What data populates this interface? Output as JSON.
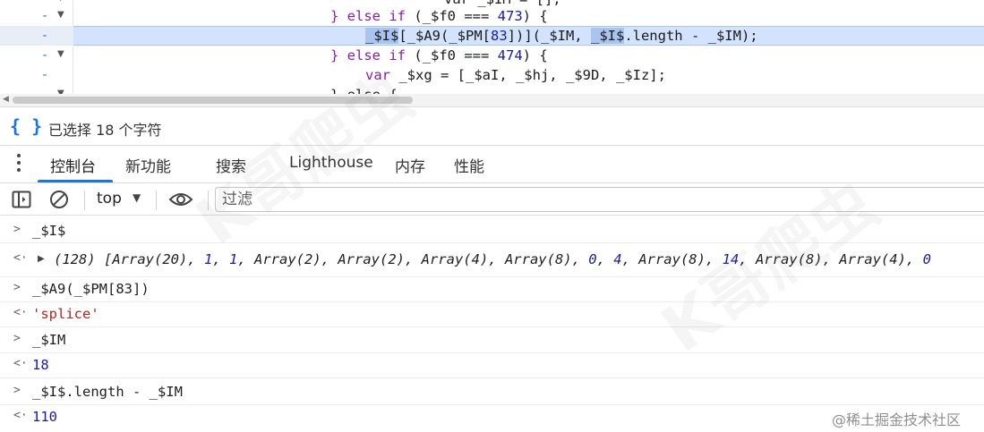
{
  "editor": {
    "lines": [
      {
        "minus": "-",
        "arrow": "▼",
        "pre": "            var _$IM = [];"
      },
      {
        "minus": "-",
        "arrow": "▼",
        "kw": "} else if",
        "pre": " (_$f0 === ",
        "num": "473",
        "post": ") {"
      },
      {
        "minus": "-",
        "active": true,
        "sel1": "_$I$",
        "mid1": "[_$A9(_$PM[",
        "num": "83",
        "mid2": "])](_$IM, ",
        "sel2": "_$I$",
        "tail": ".length - _$IM);"
      },
      {
        "minus": "-",
        "arrow": "▼",
        "kw": "} else if",
        "pre": " (_$f0 === ",
        "num": "474",
        "post": ") {"
      },
      {
        "minus": "-",
        "kw": "var",
        "pre": " _$xg = [_$aI, _$hj, _$9D, _$Iz];"
      },
      {
        "arrow": "▼",
        "pre": "} else {"
      }
    ]
  },
  "status": {
    "icon": "{ }",
    "text": "已选择 18 个字符"
  },
  "tabs": [
    {
      "label": "控制台",
      "active": true
    },
    {
      "label": "新功能"
    },
    {
      "label": "搜索"
    },
    {
      "label": "Lighthouse"
    },
    {
      "label": "内存"
    },
    {
      "label": "性能"
    }
  ],
  "toolbar": {
    "context": "top",
    "filter_placeholder": "过滤"
  },
  "console": {
    "entries": [
      {
        "kind": "input",
        "prompt": ">",
        "text": "_$I$"
      },
      {
        "kind": "array",
        "prompt": "<·",
        "triangle": "▶",
        "parts": [
          "(128) [Array(20), ",
          "1",
          ", ",
          "1",
          ", Array(2), Array(2), Array(4), Array(8), ",
          "0",
          ", ",
          "4",
          ", Array(8), ",
          "14",
          ", Array(8), Array(4), ",
          "0"
        ]
      },
      {
        "kind": "input",
        "prompt": ">",
        "text": "_$A9(_$PM[83])"
      },
      {
        "kind": "string",
        "prompt": "<·",
        "text": "'splice'"
      },
      {
        "kind": "input",
        "prompt": ">",
        "text": "_$IM"
      },
      {
        "kind": "number",
        "prompt": "<·",
        "text": "18"
      },
      {
        "kind": "input",
        "prompt": ">",
        "text": "_$I$.length - _$IM"
      },
      {
        "kind": "number",
        "prompt": "<·",
        "text": "110"
      }
    ]
  },
  "watermark": {
    "credit": "@稀土掘金技术社区"
  },
  "colors": {
    "accent": "#1a73e8",
    "selection_line": "#d3e3fd",
    "string": "#b3261e",
    "number": "#1a1aa6"
  }
}
